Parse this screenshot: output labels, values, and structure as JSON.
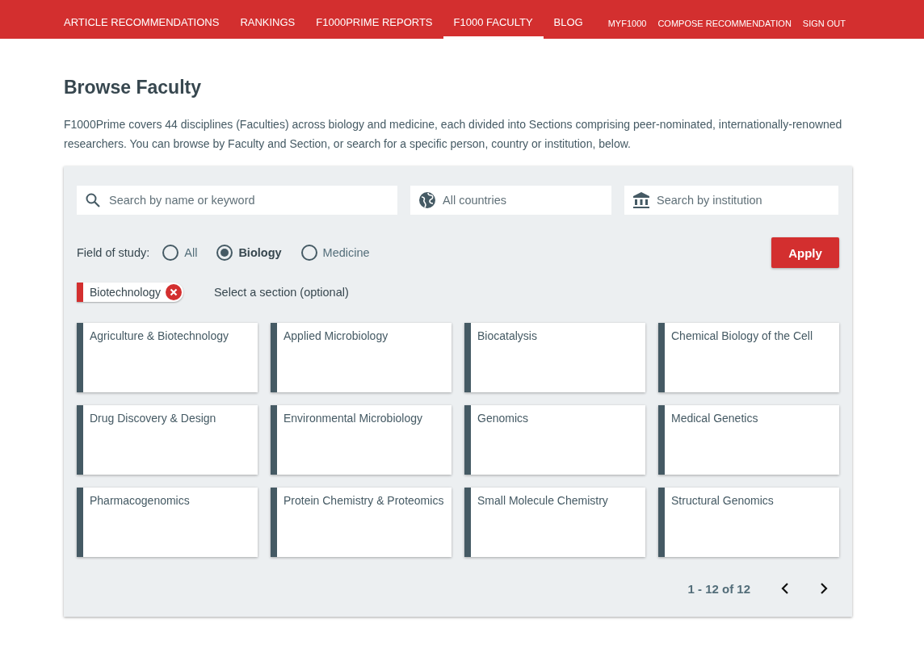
{
  "nav": {
    "items": [
      {
        "label": "ARTICLE RECOMMENDATIONS",
        "selected": false
      },
      {
        "label": "RANKINGS",
        "selected": false
      },
      {
        "label": "F1000PRIME REPORTS",
        "selected": false
      },
      {
        "label": "F1000 FACULTY",
        "selected": true
      },
      {
        "label": "BLOG",
        "selected": false
      }
    ],
    "links": [
      "MYF1000",
      "COMPOSE RECOMMENDATION",
      "SIGN OUT"
    ]
  },
  "title": "Browse Faculty",
  "intro": "F1000Prime covers 44 disciplines (Faculties) across biology and medicine, each divided into Sections comprising peer-nominated, internationally-renowned researchers. You can browse by Faculty and Section, or search for a specific person, country or institution, below.",
  "search": {
    "fields": [
      {
        "kind": "search",
        "placeholder": "Search by name or keyword"
      },
      {
        "kind": "country",
        "placeholder": "All countries"
      },
      {
        "kind": "institution",
        "placeholder": "Search by institution"
      }
    ]
  },
  "field_of_study": {
    "label": "Field of study:",
    "options": [
      {
        "label": "All",
        "selected": false
      },
      {
        "label": "Biology",
        "selected": true
      },
      {
        "label": "Medicine",
        "selected": false
      }
    ]
  },
  "apply_button": "Apply",
  "faculty_chip": "Biotechnology",
  "section_hint": "Select a section (optional)",
  "sections": [
    "Agriculture & Biotechnology",
    "Applied Microbiology",
    "Biocatalysis",
    "Chemical Biology of the Cell",
    "Drug Discovery & Design",
    "Environmental Microbiology",
    "Genomics",
    "Medical Genetics",
    "Pharmacogenomics",
    "Protein Chemistry & Proteomics",
    "Small Molecule Chemistry",
    "Structural Genomics"
  ],
  "pagination": "1 - 12 of 12"
}
